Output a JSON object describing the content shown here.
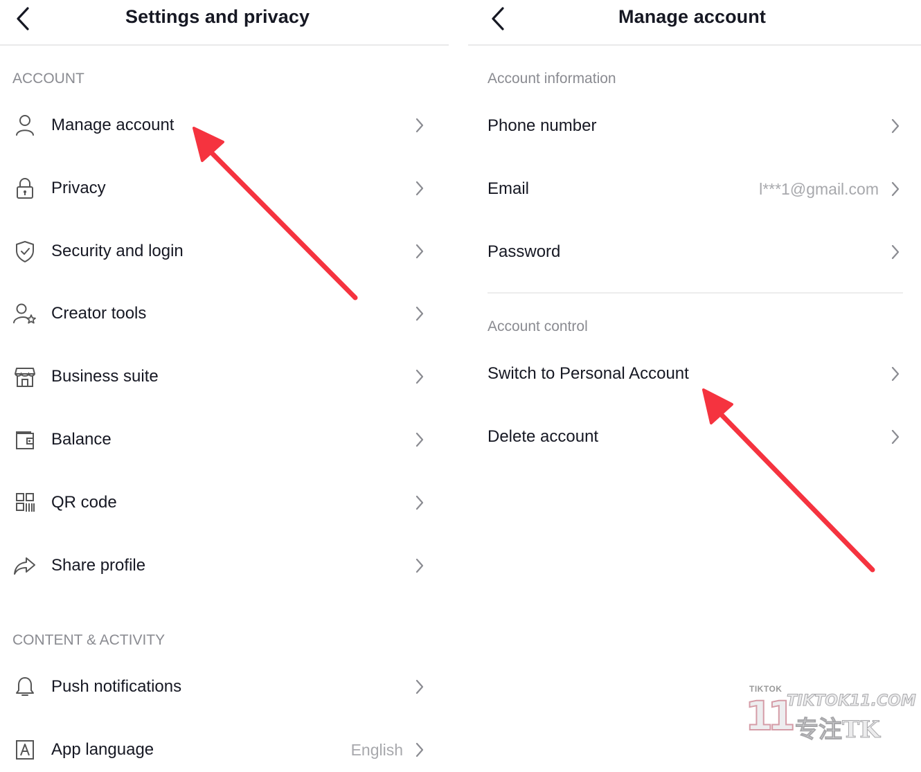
{
  "left_panel": {
    "title": "Settings and privacy",
    "sections": [
      {
        "label": "ACCOUNT",
        "items": [
          {
            "label": "Manage account",
            "icon": "person-icon"
          },
          {
            "label": "Privacy",
            "icon": "lock-icon"
          },
          {
            "label": "Security and login",
            "icon": "shield-icon"
          },
          {
            "label": "Creator tools",
            "icon": "creator-star-icon"
          },
          {
            "label": "Business suite",
            "icon": "storefront-icon"
          },
          {
            "label": "Balance",
            "icon": "wallet-icon"
          },
          {
            "label": "QR code",
            "icon": "qr-code-icon"
          },
          {
            "label": "Share profile",
            "icon": "share-arrow-icon"
          }
        ]
      },
      {
        "label": "CONTENT & ACTIVITY",
        "items": [
          {
            "label": "Push notifications",
            "icon": "bell-icon"
          },
          {
            "label": "App language",
            "icon": "language-a-icon",
            "value": "English"
          }
        ]
      }
    ]
  },
  "right_panel": {
    "title": "Manage account",
    "sections": [
      {
        "label": "Account information",
        "items": [
          {
            "label": "Phone number"
          },
          {
            "label": "Email",
            "value": "l***1@gmail.com"
          },
          {
            "label": "Password"
          }
        ]
      },
      {
        "label": "Account control",
        "items": [
          {
            "label": "Switch to Personal Account"
          },
          {
            "label": "Delete account"
          }
        ]
      }
    ]
  },
  "colors": {
    "text_primary": "#161823",
    "text_secondary": "#8a8b91",
    "annotation_arrow": "#f5333f"
  },
  "watermark": {
    "small_text": "TIKTOK",
    "number": "11",
    "domain": "TIKTOK11.COM",
    "slogan": "专注TK"
  }
}
